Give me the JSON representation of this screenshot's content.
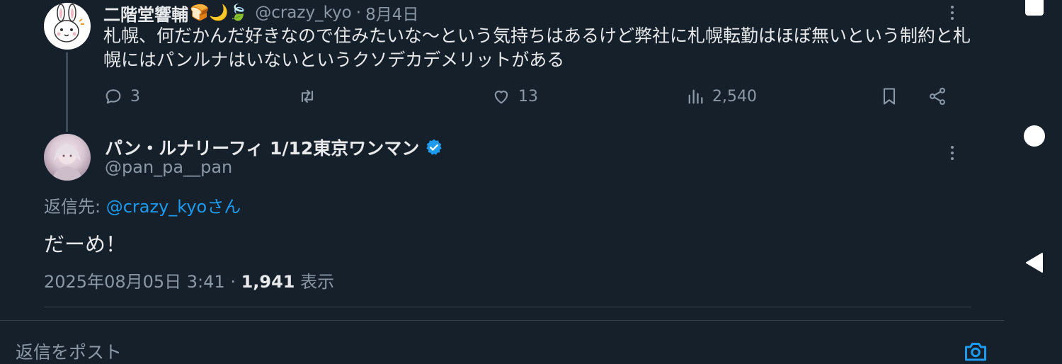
{
  "parent_tweet": {
    "display_name": "二階堂響輔",
    "name_emojis": "🍞🌙🍃",
    "handle": "@crazy_kyo",
    "separator": "·",
    "date": "8月4日",
    "text": "札幌、何だかんだ好きなので住みたいな〜という気持ちはあるけど弊社に札幌転勤はほぼ無いという制約と札幌にはパンルナはいないというクソデカデメリットがある",
    "replies": "3",
    "retweets": "",
    "likes": "13",
    "views": "2,540"
  },
  "main_tweet": {
    "display_name": "パン・ルナリーフィ 1/12東京ワンマン",
    "handle": "@pan_pa__pan",
    "reply_prefix": "返信先: ",
    "reply_target": "@crazy_kyoさん",
    "text": "だーめ！",
    "timestamp": "2025年08月05日 3:41",
    "meta_separator": " · ",
    "view_count": "1,941",
    "view_label": " 表示"
  },
  "composer": {
    "placeholder": "返信をポスト"
  },
  "colors": {
    "background": "#15202b",
    "text": "#e7e9ea",
    "muted": "#8b98a5",
    "link": "#1d9bf0",
    "verified": "#1d9bf0"
  },
  "icons": {
    "reply": "reply-icon",
    "retweet": "retweet-icon",
    "like": "heart-icon",
    "views": "analytics-icon",
    "bookmark": "bookmark-icon",
    "share": "share-icon",
    "more": "more-icon",
    "camera": "camera-icon",
    "verified": "verified-badge-icon"
  }
}
